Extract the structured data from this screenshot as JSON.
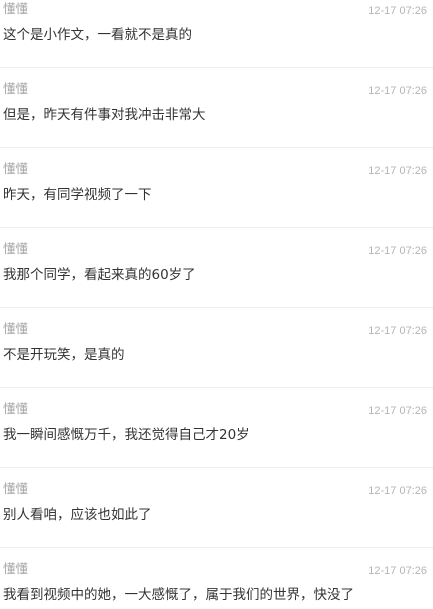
{
  "comments": [
    {
      "user": "懂懂",
      "time": "12-17 07:26",
      "text": "这个是小作文，一看就不是真的"
    },
    {
      "user": "懂懂",
      "time": "12-17 07:26",
      "text": "但是，昨天有件事对我冲击非常大"
    },
    {
      "user": "懂懂",
      "time": "12-17 07:26",
      "text": "昨天，有同学视频了一下"
    },
    {
      "user": "懂懂",
      "time": "12-17 07:26",
      "text": "我那个同学，看起来真的60岁了"
    },
    {
      "user": "懂懂",
      "time": "12-17 07:26",
      "text": "不是开玩笑，是真的"
    },
    {
      "user": "懂懂",
      "time": "12-17 07:26",
      "text": "我一瞬间感慨万千，我还觉得自己才20岁"
    },
    {
      "user": "懂懂",
      "time": "12-17 07:26",
      "text": "别人看咱，应该也如此了"
    },
    {
      "user": "懂懂",
      "time": "12-17 07:26",
      "text": "我看到视频中的她，一大感慨了，属于我们的世界，快没了"
    }
  ]
}
